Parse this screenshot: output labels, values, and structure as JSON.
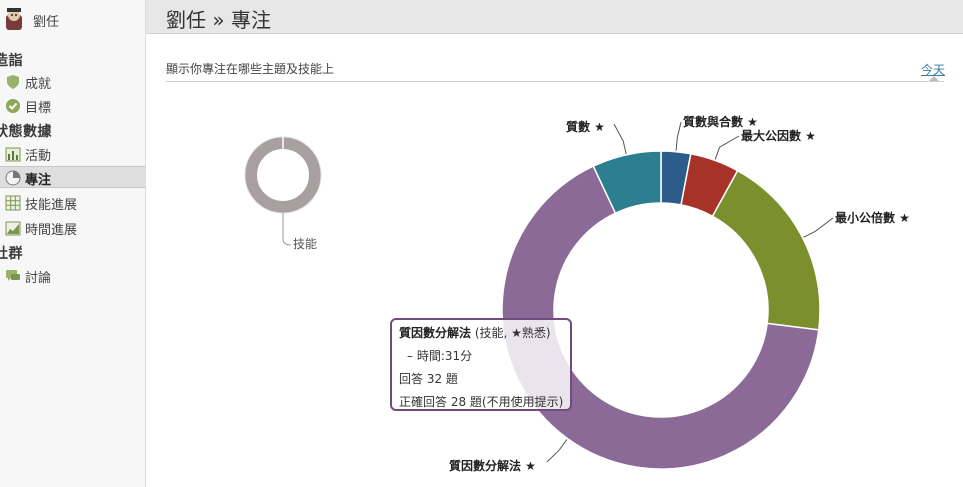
{
  "user": {
    "name": "劉任"
  },
  "sidebar": {
    "sections": [
      {
        "label": "造詣",
        "items": [
          {
            "label": "成就",
            "icon": "shield-icon"
          },
          {
            "label": "目標",
            "icon": "check-circle-icon"
          }
        ]
      },
      {
        "label": "狀態數據",
        "items": [
          {
            "label": "活動",
            "icon": "bar-chart-icon"
          },
          {
            "label": "專注",
            "icon": "pie-chart-icon",
            "active": true
          },
          {
            "label": "技能進展",
            "icon": "grid-icon"
          },
          {
            "label": "時間進展",
            "icon": "area-chart-icon"
          }
        ]
      },
      {
        "label": "社群",
        "items": [
          {
            "label": "討論",
            "icon": "speech-bubble-icon"
          }
        ]
      }
    ]
  },
  "header": {
    "title": "劉任 » 專注"
  },
  "page": {
    "subtitle": "顯示你專注在哪些主題及技能上",
    "period_link": "今天"
  },
  "colors": {
    "accent_link": "#3a7aa0",
    "tooltip_border": "#6e4d7e"
  },
  "chart_data": {
    "type": "pie",
    "title": "",
    "slices": [
      {
        "label": "質數與合數 ★",
        "value": 3,
        "color": "#2e5c8a"
      },
      {
        "label": "最大公因數 ★",
        "value": 5,
        "color": "#a63228"
      },
      {
        "label": "最小公倍數 ★",
        "value": 19,
        "color": "#7b8f2d"
      },
      {
        "label": "質因數分解法 ★",
        "value": 66,
        "color": "#8b6a97"
      },
      {
        "label": "質數 ★",
        "value": 7,
        "color": "#2b7f91"
      }
    ],
    "mini": {
      "label": "技能",
      "value": 100,
      "color": "#a8a0a0"
    }
  },
  "tooltip": {
    "title": "質因數分解法",
    "title_suffix": "(技能, ★熟悉)",
    "time": "– 時間:31分",
    "answered": "回答 32 題",
    "correct": "正確回答 28 題(不用使用提示)"
  }
}
